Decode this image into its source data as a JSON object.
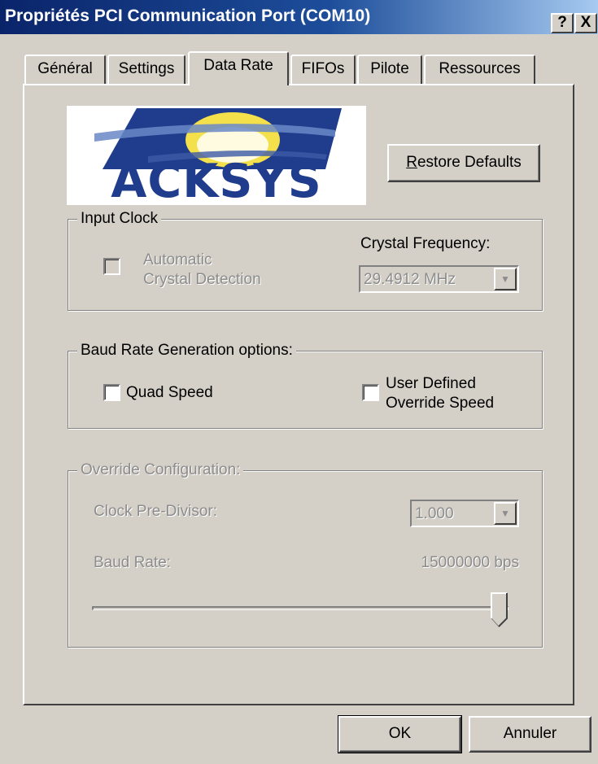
{
  "window": {
    "title": "Propriétés PCI Communication Port (COM10)",
    "help_label": "?",
    "close_label": "X"
  },
  "tabs": [
    {
      "label": "Général",
      "active": false
    },
    {
      "label": "Settings",
      "active": false
    },
    {
      "label": "Data Rate",
      "active": true
    },
    {
      "label": "FIFOs",
      "active": false
    },
    {
      "label": "Pilote",
      "active": false
    },
    {
      "label": "Ressources",
      "active": false
    }
  ],
  "logo": {
    "text": "ACKSYS"
  },
  "restore_defaults": {
    "label": "Restore Defaults",
    "mnemonic": "R"
  },
  "input_clock": {
    "title": "Input Clock",
    "automatic_label_line1": "Automatic",
    "automatic_label_line2": "Crystal Detection",
    "automatic_checked": false,
    "crystal_freq_label": "Crystal Frequency:",
    "crystal_freq_value": "29.4912 MHz"
  },
  "baud_options": {
    "title": "Baud Rate Generation options:",
    "quad_speed_label": "Quad Speed",
    "quad_speed_checked": false,
    "user_defined_line1": "User Defined",
    "user_defined_line2": "Override Speed",
    "user_defined_checked": false
  },
  "override": {
    "title": "Override Configuration:",
    "clock_prediv_label": "Clock Pre-Divisor:",
    "clock_prediv_value": "1.000",
    "baud_rate_label": "Baud Rate:",
    "baud_rate_value": "15000000 bps",
    "slider_fraction": 1.0
  },
  "footer": {
    "ok_label": "OK",
    "cancel_label": "Annuler"
  },
  "colors": {
    "titlebar_start": "#0a246a",
    "titlebar_end": "#a6caf0",
    "face": "#d4d0c8",
    "disabled_text": "#8c8c8c",
    "logo_blue": "#1f3d8c",
    "logo_yellow": "#f4e04a"
  }
}
